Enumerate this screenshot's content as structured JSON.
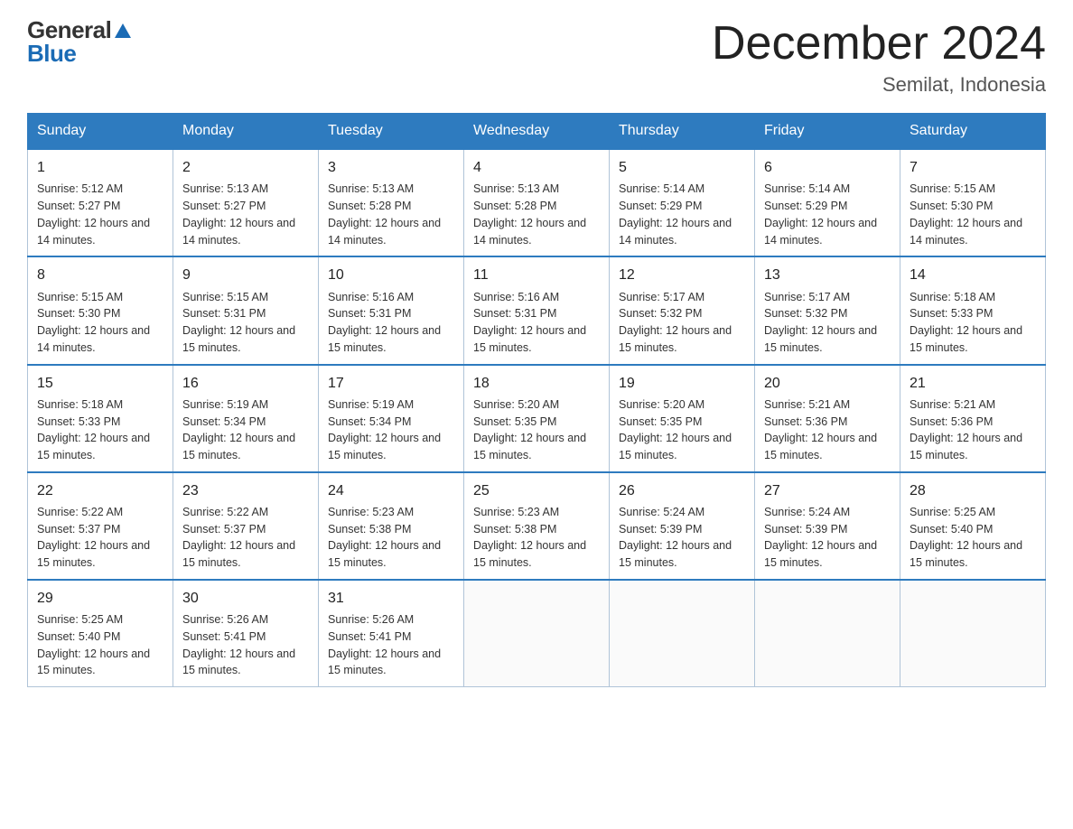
{
  "logo": {
    "general": "General",
    "blue": "Blue"
  },
  "title": "December 2024",
  "location": "Semilat, Indonesia",
  "weekdays": [
    "Sunday",
    "Monday",
    "Tuesday",
    "Wednesday",
    "Thursday",
    "Friday",
    "Saturday"
  ],
  "weeks": [
    [
      {
        "day": "1",
        "sunrise": "5:12 AM",
        "sunset": "5:27 PM",
        "daylight": "12 hours and 14 minutes."
      },
      {
        "day": "2",
        "sunrise": "5:13 AM",
        "sunset": "5:27 PM",
        "daylight": "12 hours and 14 minutes."
      },
      {
        "day": "3",
        "sunrise": "5:13 AM",
        "sunset": "5:28 PM",
        "daylight": "12 hours and 14 minutes."
      },
      {
        "day": "4",
        "sunrise": "5:13 AM",
        "sunset": "5:28 PM",
        "daylight": "12 hours and 14 minutes."
      },
      {
        "day": "5",
        "sunrise": "5:14 AM",
        "sunset": "5:29 PM",
        "daylight": "12 hours and 14 minutes."
      },
      {
        "day": "6",
        "sunrise": "5:14 AM",
        "sunset": "5:29 PM",
        "daylight": "12 hours and 14 minutes."
      },
      {
        "day": "7",
        "sunrise": "5:15 AM",
        "sunset": "5:30 PM",
        "daylight": "12 hours and 14 minutes."
      }
    ],
    [
      {
        "day": "8",
        "sunrise": "5:15 AM",
        "sunset": "5:30 PM",
        "daylight": "12 hours and 14 minutes."
      },
      {
        "day": "9",
        "sunrise": "5:15 AM",
        "sunset": "5:31 PM",
        "daylight": "12 hours and 15 minutes."
      },
      {
        "day": "10",
        "sunrise": "5:16 AM",
        "sunset": "5:31 PM",
        "daylight": "12 hours and 15 minutes."
      },
      {
        "day": "11",
        "sunrise": "5:16 AM",
        "sunset": "5:31 PM",
        "daylight": "12 hours and 15 minutes."
      },
      {
        "day": "12",
        "sunrise": "5:17 AM",
        "sunset": "5:32 PM",
        "daylight": "12 hours and 15 minutes."
      },
      {
        "day": "13",
        "sunrise": "5:17 AM",
        "sunset": "5:32 PM",
        "daylight": "12 hours and 15 minutes."
      },
      {
        "day": "14",
        "sunrise": "5:18 AM",
        "sunset": "5:33 PM",
        "daylight": "12 hours and 15 minutes."
      }
    ],
    [
      {
        "day": "15",
        "sunrise": "5:18 AM",
        "sunset": "5:33 PM",
        "daylight": "12 hours and 15 minutes."
      },
      {
        "day": "16",
        "sunrise": "5:19 AM",
        "sunset": "5:34 PM",
        "daylight": "12 hours and 15 minutes."
      },
      {
        "day": "17",
        "sunrise": "5:19 AM",
        "sunset": "5:34 PM",
        "daylight": "12 hours and 15 minutes."
      },
      {
        "day": "18",
        "sunrise": "5:20 AM",
        "sunset": "5:35 PM",
        "daylight": "12 hours and 15 minutes."
      },
      {
        "day": "19",
        "sunrise": "5:20 AM",
        "sunset": "5:35 PM",
        "daylight": "12 hours and 15 minutes."
      },
      {
        "day": "20",
        "sunrise": "5:21 AM",
        "sunset": "5:36 PM",
        "daylight": "12 hours and 15 minutes."
      },
      {
        "day": "21",
        "sunrise": "5:21 AM",
        "sunset": "5:36 PM",
        "daylight": "12 hours and 15 minutes."
      }
    ],
    [
      {
        "day": "22",
        "sunrise": "5:22 AM",
        "sunset": "5:37 PM",
        "daylight": "12 hours and 15 minutes."
      },
      {
        "day": "23",
        "sunrise": "5:22 AM",
        "sunset": "5:37 PM",
        "daylight": "12 hours and 15 minutes."
      },
      {
        "day": "24",
        "sunrise": "5:23 AM",
        "sunset": "5:38 PM",
        "daylight": "12 hours and 15 minutes."
      },
      {
        "day": "25",
        "sunrise": "5:23 AM",
        "sunset": "5:38 PM",
        "daylight": "12 hours and 15 minutes."
      },
      {
        "day": "26",
        "sunrise": "5:24 AM",
        "sunset": "5:39 PM",
        "daylight": "12 hours and 15 minutes."
      },
      {
        "day": "27",
        "sunrise": "5:24 AM",
        "sunset": "5:39 PM",
        "daylight": "12 hours and 15 minutes."
      },
      {
        "day": "28",
        "sunrise": "5:25 AM",
        "sunset": "5:40 PM",
        "daylight": "12 hours and 15 minutes."
      }
    ],
    [
      {
        "day": "29",
        "sunrise": "5:25 AM",
        "sunset": "5:40 PM",
        "daylight": "12 hours and 15 minutes."
      },
      {
        "day": "30",
        "sunrise": "5:26 AM",
        "sunset": "5:41 PM",
        "daylight": "12 hours and 15 minutes."
      },
      {
        "day": "31",
        "sunrise": "5:26 AM",
        "sunset": "5:41 PM",
        "daylight": "12 hours and 15 minutes."
      },
      null,
      null,
      null,
      null
    ]
  ]
}
